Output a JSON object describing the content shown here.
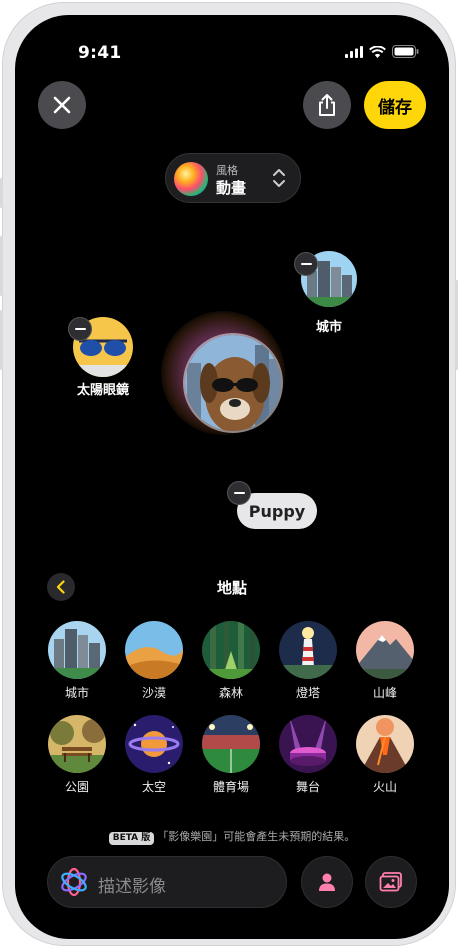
{
  "status": {
    "time": "9:41"
  },
  "top_bar": {
    "save_label": "儲存"
  },
  "style_picker": {
    "caption": "風格",
    "value": "動畫"
  },
  "canvas": {
    "concepts": [
      {
        "id": "city",
        "label": "城市"
      },
      {
        "id": "sunglasses",
        "label": "太陽眼鏡"
      },
      {
        "id": "puppy",
        "label": "Puppy"
      }
    ]
  },
  "suggestions": {
    "title": "地點",
    "items": [
      {
        "label": "城市",
        "icon": "city-thumbnail"
      },
      {
        "label": "沙漠",
        "icon": "desert-thumbnail"
      },
      {
        "label": "森林",
        "icon": "forest-thumbnail"
      },
      {
        "label": "燈塔",
        "icon": "lighthouse-thumbnail"
      },
      {
        "label": "山峰",
        "icon": "mountain-thumbnail"
      },
      {
        "label": "公園",
        "icon": "park-thumbnail"
      },
      {
        "label": "太空",
        "icon": "space-thumbnail"
      },
      {
        "label": "體育場",
        "icon": "stadium-thumbnail"
      },
      {
        "label": "舞台",
        "icon": "stage-thumbnail"
      },
      {
        "label": "火山",
        "icon": "volcano-thumbnail"
      }
    ]
  },
  "disclaimer": {
    "badge": "BETA 版",
    "text": "「影像樂園」可能會產生未預期的結果。"
  },
  "prompt": {
    "placeholder": "描述影像"
  },
  "colors": {
    "accent": "#ffd60a",
    "background": "#000000",
    "button": "#4a4a4f"
  }
}
